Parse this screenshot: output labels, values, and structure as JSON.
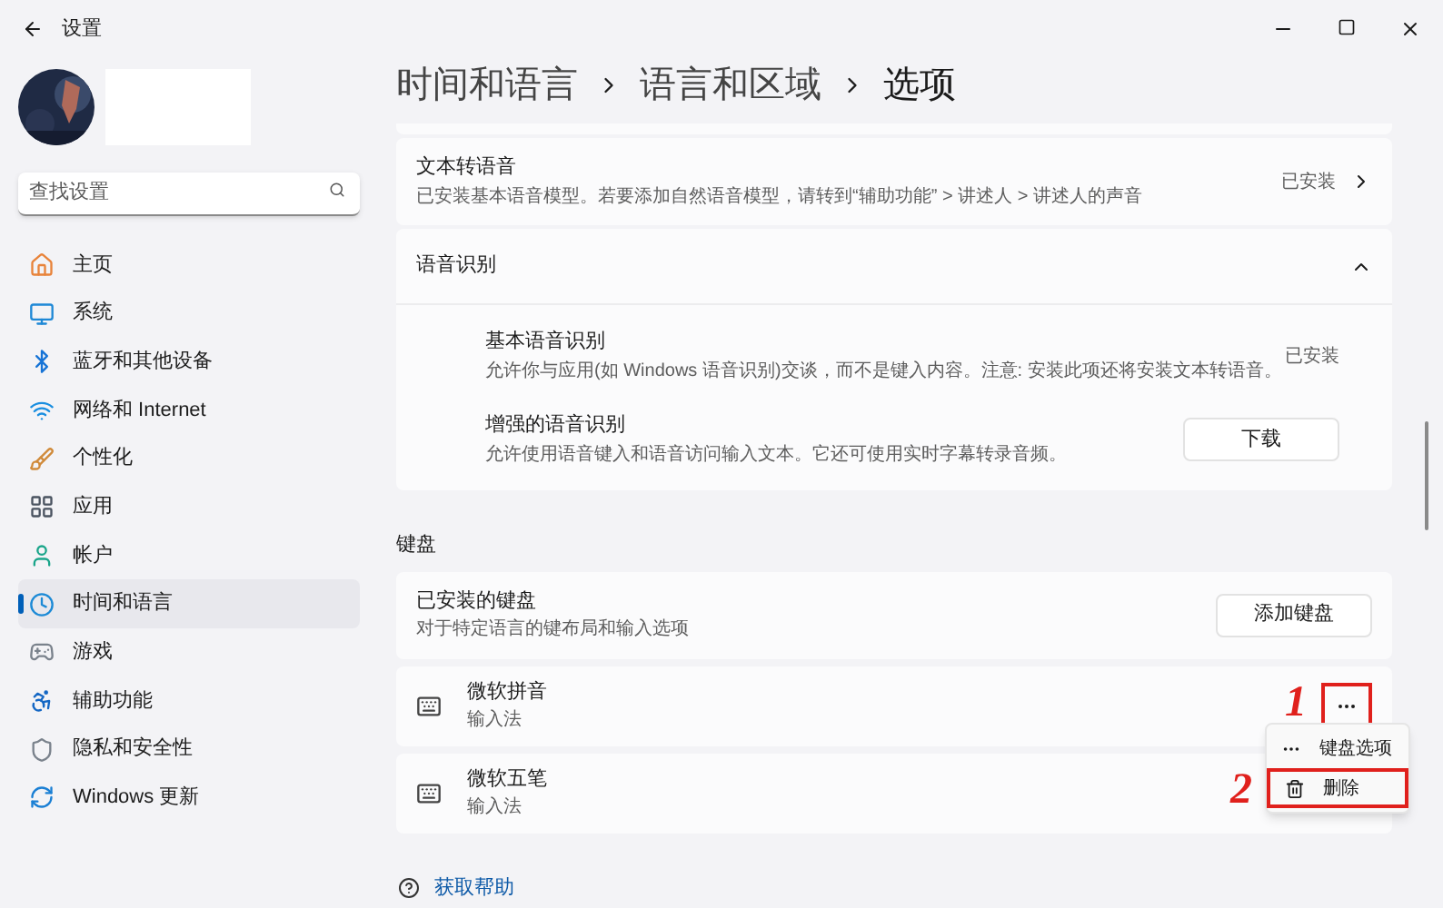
{
  "window": {
    "title": "设置"
  },
  "search": {
    "placeholder": "查找设置"
  },
  "nav": [
    {
      "label": "主页",
      "selected": false
    },
    {
      "label": "系统",
      "selected": false
    },
    {
      "label": "蓝牙和其他设备",
      "selected": false
    },
    {
      "label": "网络和 Internet",
      "selected": false
    },
    {
      "label": "个性化",
      "selected": false
    },
    {
      "label": "应用",
      "selected": false
    },
    {
      "label": "帐户",
      "selected": false
    },
    {
      "label": "时间和语言",
      "selected": true
    },
    {
      "label": "游戏",
      "selected": false
    },
    {
      "label": "辅助功能",
      "selected": false
    },
    {
      "label": "隐私和安全性",
      "selected": false
    },
    {
      "label": "Windows 更新",
      "selected": false
    }
  ],
  "breadcrumb": [
    "时间和语言",
    "语言和区域",
    "选项"
  ],
  "tts": {
    "title": "文本转语音",
    "description": "已安装基本语音模型。若要添加自然语音模型，请转到“辅助功能” > 讲述人 > 讲述人的声音",
    "status": "已安装"
  },
  "speech": {
    "title": "语音识别",
    "expanded": true,
    "items": [
      {
        "kind": "status",
        "title": "基本语音识别",
        "description": "允许你与应用(如 Windows 语音识别)交谈，而不是键入内容。注意: 安装此项还将安装文本转语音。",
        "value": "已安装"
      },
      {
        "kind": "button",
        "title": "增强的语音识别",
        "description": "允许使用语音键入和语音访问输入文本。它还可使用实时字幕转录音频。",
        "value": "下载"
      }
    ]
  },
  "keyboard": {
    "label": "键盘",
    "title": "已安装的键盘",
    "description": "对于特定语言的键布局和输入选项",
    "button": "添加键盘",
    "items": [
      {
        "name": "微软拼音",
        "type": "输入法",
        "highlighted": true,
        "annotation": "1"
      },
      {
        "name": "微软五笔",
        "type": "输入法"
      }
    ]
  },
  "menu": {
    "items": [
      {
        "label": "键盘选项",
        "highlighted": false
      },
      {
        "label": "删除",
        "highlighted": true,
        "annotation": "2"
      }
    ]
  },
  "help": {
    "label": "获取帮助"
  }
}
